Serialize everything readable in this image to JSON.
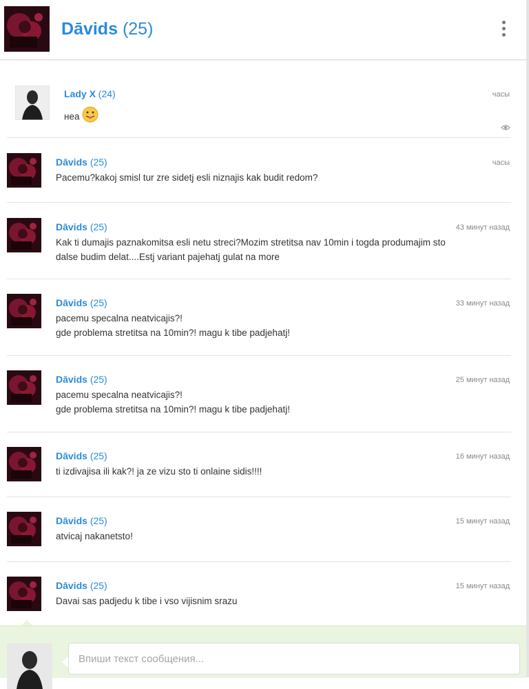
{
  "header": {
    "name": "Dāvids",
    "age": "(25)"
  },
  "messages": [
    {
      "author": "Lady X",
      "age": "(24)",
      "time": "часы",
      "lines": [
        "неа"
      ],
      "emoji": "tongue-face",
      "avatar": "female-avatar",
      "seen": true
    },
    {
      "author": "Dāvids",
      "age": "(25)",
      "time": "часы",
      "lines": [
        "Pacemu?kakoj smisl tur zre sidetj esli niznajis kak budit redom?"
      ]
    },
    {
      "author": "Dāvids",
      "age": "(25)",
      "time": "43 минут назад",
      "lines": [
        "Kak ti dumajis paznakomitsa esli netu streci?Mozim stretitsa nav 10min i togda produmajim sto",
        "dalse budim delat....Estj variant pajehatj gulat na more"
      ]
    },
    {
      "author": "Dāvids",
      "age": "(25)",
      "time": "33 минут назад",
      "lines": [
        "pacemu specalna neatvicajis?!",
        "gde problema stretitsa na 10min?! magu k tibe padjehatj!"
      ]
    },
    {
      "author": "Dāvids",
      "age": "(25)",
      "time": "25 минут назад",
      "lines": [
        "pacemu specalna neatvicajis?!",
        "gde problema stretitsa na 10min?! magu k tibe padjehatj!"
      ]
    },
    {
      "author": "Dāvids",
      "age": "(25)",
      "time": "16 минут назад",
      "lines": [
        "ti izdivajisa ili kak?! ja ze vizu sto ti onlaine sidis!!!!"
      ]
    },
    {
      "author": "Dāvids",
      "age": "(25)",
      "time": "15 минут назад",
      "lines": [
        "atvicaj nakanetsto!"
      ]
    },
    {
      "author": "Dāvids",
      "age": "(25)",
      "time": "15 минут назад",
      "lines": [
        "Davai sas padjedu k tibe i vso vijisnim srazu"
      ]
    }
  ],
  "composer": {
    "placeholder": "Впиши текст сообщения..."
  }
}
